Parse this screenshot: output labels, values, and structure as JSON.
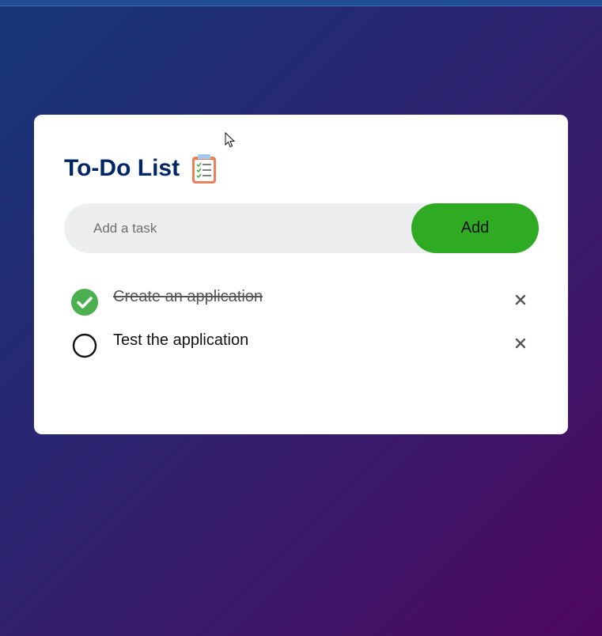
{
  "app": {
    "title": "To-Do List",
    "title_icon": "clipboard-checklist-icon"
  },
  "input": {
    "placeholder": "Add a task",
    "value": "",
    "add_label": "Add"
  },
  "tasks": [
    {
      "text": "Create an application",
      "completed": true
    },
    {
      "text": "Test the application",
      "completed": false
    }
  ],
  "icons": {
    "checked": "check-circle-icon",
    "unchecked": "empty-circle-icon",
    "delete": "close-icon"
  },
  "colors": {
    "title": "#002765",
    "accent": "#2eaa23",
    "checked": "#4caf50",
    "input_bg": "#edeef0",
    "background_start": "#153677",
    "background_end": "#4e085f"
  }
}
